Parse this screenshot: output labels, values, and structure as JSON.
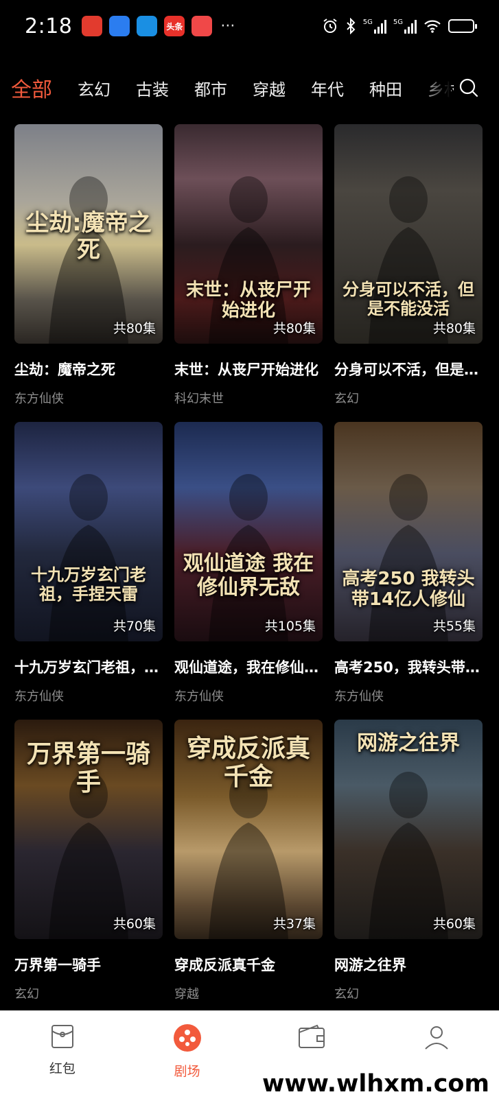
{
  "status_bar": {
    "time": "2:18",
    "app_icons": [
      {
        "name": "red-app-icon",
        "color": "#e23b2e",
        "glyph": ""
      },
      {
        "name": "shield-app-icon",
        "color": "#2b7df0",
        "glyph": ""
      },
      {
        "name": "browser-app-icon",
        "color": "#1a8fe3",
        "glyph": ""
      },
      {
        "name": "toutiao-app-icon",
        "color": "#e8312a",
        "glyph": "头条"
      },
      {
        "name": "gift-app-icon",
        "color": "#f04848",
        "glyph": ""
      }
    ],
    "more": "···",
    "network_label": "5G"
  },
  "tabs": [
    "全部",
    "玄幻",
    "古装",
    "都市",
    "穿越",
    "年代",
    "种田",
    "乡村"
  ],
  "active_tab": 0,
  "dramas": [
    {
      "title": "尘劫：魔帝之死",
      "genre": "东方仙侠",
      "episodes": "共80集",
      "poster_text": "尘劫:魔帝之死",
      "bg": "linear-gradient(180deg,#7d8088 0%,#a9a59a 35%,#c9bb8a 55%,#58534a 80%,#2a2622 100%)",
      "text_top": 125,
      "text_size": 34
    },
    {
      "title": "末世：从丧尸开始进化",
      "genre": "科幻末世",
      "episodes": "共80集",
      "poster_text": "末世：从丧尸开始进化",
      "bg": "linear-gradient(180deg,#3a2a30 0%,#6d4f58 25%,#2b1c1f 55%,#4a1a1a 80%,#1d0d0d 100%)",
      "text_top": 228,
      "text_size": 26
    },
    {
      "title": "分身可以不活，但是不能没活",
      "genre": "玄幻",
      "episodes": "共80集",
      "poster_text": "分身可以不活，但是不能没活",
      "bg": "linear-gradient(180deg,#2a2a2c 0%,#4a4640 30%,#3b3833 60%,#26241f 100%)",
      "text_top": 228,
      "text_size": 24
    },
    {
      "title": "十九万岁玄门老祖，手捏天雷",
      "genre": "东方仙侠",
      "episodes": "共70集",
      "poster_text": "十九万岁玄门老祖，手捏天雷",
      "bg": "linear-gradient(180deg,#1d2440 0%,#3d4a7a 30%,#22283c 60%,#111420 100%)",
      "text_top": 210,
      "text_size": 24
    },
    {
      "title": "观仙道途，我在修仙界无敌",
      "genre": "东方仙侠",
      "episodes": "共105集",
      "poster_text": "观仙道途 我在修仙界无敌",
      "bg": "linear-gradient(180deg,#1c2a50 0%,#3a4f86 30%,#4a1e28 60%,#1a0c10 100%)",
      "text_top": 190,
      "text_size": 30
    },
    {
      "title": "高考250，我转头带14亿人修仙",
      "genre": "东方仙侠",
      "episodes": "共55集",
      "poster_text": "高考250 我转头带14亿人修仙",
      "bg": "linear-gradient(180deg,#4a3520 0%,#6a5a48 30%,#4a4d60 60%,#25222a 100%)",
      "text_top": 215,
      "text_size": 26
    },
    {
      "title": "万界第一骑手",
      "genre": "玄幻",
      "episodes": "共60集",
      "poster_text": "万界第一骑手",
      "bg": "linear-gradient(180deg,#2a1a0e 0%,#6a4a22 30%,#2a2630 60%,#141216 100%)",
      "text_top": 30,
      "text_size": 36
    },
    {
      "title": "穿成反派真千金",
      "genre": "穿越",
      "episodes": "共37集",
      "poster_text": "穿成反派真千金",
      "bg": "linear-gradient(180deg,#3a2410 0%,#7a5a2a 35%,#b89a6a 60%,#5a4630 85%,#2a2016 100%)",
      "text_top": 22,
      "text_size": 36
    },
    {
      "title": "网游之往界",
      "genre": "玄幻",
      "episodes": "共60集",
      "poster_text": "网游之往界",
      "bg": "linear-gradient(180deg,#2a3a48 0%,#4a5a66 30%,#3a3028 60%,#1c1a18 100%)",
      "text_top": 18,
      "text_size": 30
    }
  ],
  "peek_colors": [
    "#6a5a3a",
    "#4a3a30",
    "#5a3a30"
  ],
  "bottom_nav": [
    {
      "label": "红包",
      "icon": "red-packet-icon",
      "active": false
    },
    {
      "label": "剧场",
      "icon": "theater-icon",
      "active": true
    },
    {
      "label": "",
      "icon": "wallet-icon",
      "active": false
    },
    {
      "label": "",
      "icon": "profile-icon",
      "active": false
    }
  ],
  "watermark": "www.wlhxm.com",
  "colors": {
    "accent": "#f25a3c",
    "background": "#000000",
    "nav_bg": "#ffffff",
    "genre_text": "#8e8e8e"
  }
}
